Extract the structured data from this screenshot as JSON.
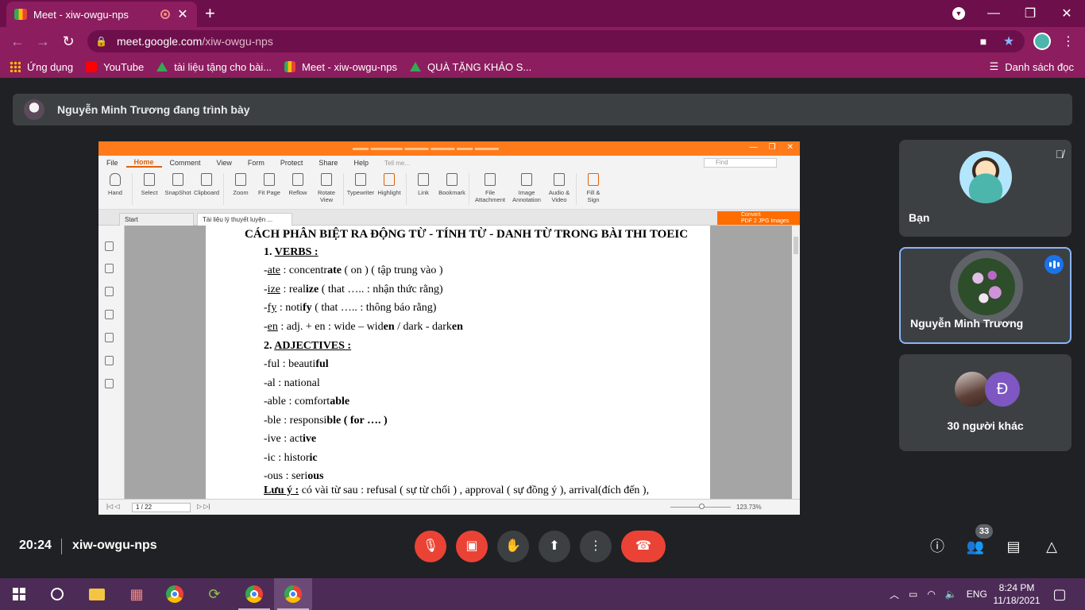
{
  "browser": {
    "tab_title": "Meet - xiw-owgu-nps",
    "new_tab": "+",
    "url_host": "meet.google.com",
    "url_path": "/xiw-owgu-nps",
    "bookmarks": [
      "Ứng dụng",
      "YouTube",
      "tài liệu tặng cho bài...",
      "Meet - xiw-owgu-nps",
      "QUÀ TẶNG KHẢO S..."
    ],
    "reading_list": "Danh sách đọc"
  },
  "meet": {
    "presenting_text": "Nguyễn Minh Trương đang trình bày",
    "meeting_time": "20:24",
    "meeting_code": "xiw-owgu-nps",
    "people_count": "33",
    "participants": [
      {
        "name": "Bạn"
      },
      {
        "name": "Nguyễn Minh Trương"
      },
      {
        "name": "30 người khác",
        "initial": "Đ"
      }
    ]
  },
  "pdf_app": {
    "menu": [
      "File",
      "Home",
      "Comment",
      "View",
      "Form",
      "Protect",
      "Share",
      "Help"
    ],
    "tell_me": "Tell me...",
    "find_placeholder": "Find",
    "ribbon": [
      "Hand",
      "Select",
      "SnapShot",
      "Clipboard",
      "Zoom",
      "Fit Page",
      "Reflow",
      "Rotate View",
      "Typewriter",
      "Highlight",
      "Link",
      "Bookmark",
      "File Attachment",
      "Image Annotation",
      "Audio & Video",
      "Fill & Sign"
    ],
    "tabs": [
      "Start",
      "Tài liệu lý thuyết luyện ..."
    ],
    "convert_badge_line1": "Convert",
    "convert_badge_line2": "PDF 2 JPG Images",
    "page_indicator": "1 / 22",
    "zoom": "123.73%",
    "document": {
      "heading": "CÁCH PHÂN BIỆT RA ĐỘNG TỪ - TÍNH TỪ - DANH TỪ TRONG BÀI THI TOEIC",
      "lines": [
        {
          "num": "1.",
          "title": "VERBS :"
        },
        {
          "pre": "-",
          "ul": "ate",
          "mid": " : concentr",
          "bold": "ate",
          "post": " ( on ) ( tập trung vào )"
        },
        {
          "pre": "-",
          "ul": "ize",
          "mid": " : real",
          "bold": "ize",
          "post": " ( that ….. : nhận thức rằng)"
        },
        {
          "pre": "-",
          "ul": "fy",
          "mid": " : noti",
          "bold": "fy",
          "post": " ( that ….. : thông báo rằng)"
        },
        {
          "pre": "-",
          "ul": "en",
          "mid": " : adj. + en : wide – wid",
          "bold": "en",
          "post": " / dark - dark",
          "bold2": "en"
        },
        {
          "num": "2.",
          "title": "ADJECTIVES :"
        },
        {
          "pre": "-ful : beauti",
          "bold": "ful"
        },
        {
          "pre": "-al : national"
        },
        {
          "pre": "-able : comfort",
          "bold": "able"
        },
        {
          "pre": "-ble : responsi",
          "bold": "ble ( for …. )"
        },
        {
          "pre": "-ive : act",
          "bold": "ive"
        },
        {
          "pre": "-ic : histor",
          "bold": "ic"
        },
        {
          "pre": "-ous : seri",
          "bold": "ous"
        },
        {
          "note_label": "Lưu ý :",
          "note_text": " có vài từ sau : refusal ( sự từ chối ) , approval ( sự đồng ý ), arrival(đích đến ),"
        }
      ]
    }
  },
  "taskbar": {
    "language": "ENG",
    "time": "8:24 PM",
    "date": "11/18/2021"
  }
}
